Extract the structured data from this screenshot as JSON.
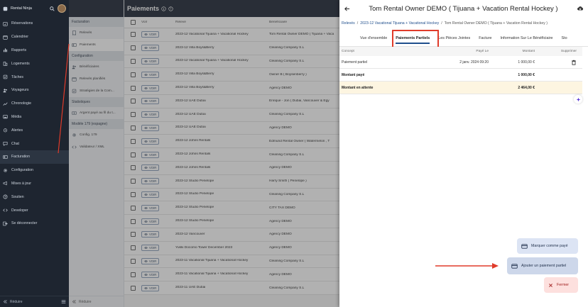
{
  "sidebar": {
    "app_name": "Rental Ninja",
    "items": [
      {
        "label": "Réservations",
        "icon": "calendar-check-icon"
      },
      {
        "label": "Calendrier",
        "icon": "calendar-icon"
      },
      {
        "label": "Rapports",
        "icon": "bar-chart-icon"
      },
      {
        "label": "Logements",
        "icon": "buildings-icon"
      },
      {
        "label": "Tâches",
        "icon": "tasks-icon"
      },
      {
        "label": "Voyageurs",
        "icon": "users-icon"
      },
      {
        "label": "Chronologie",
        "icon": "trend-icon"
      },
      {
        "label": "Média",
        "icon": "image-icon"
      },
      {
        "label": "Alertes",
        "icon": "alarm-icon"
      },
      {
        "label": "Chat",
        "icon": "chat-icon"
      },
      {
        "label": "Facturation",
        "icon": "invoice-icon"
      },
      {
        "label": "Configuration",
        "icon": "gear-icon"
      },
      {
        "label": "Mises à jour",
        "icon": "megaphone-icon"
      },
      {
        "label": "Soutien",
        "icon": "help-icon"
      },
      {
        "label": "Developer",
        "icon": "code-icon"
      },
      {
        "label": "Se déconnecter",
        "icon": "logout-icon"
      }
    ],
    "active_index": 10,
    "footer_label": "Réduire"
  },
  "subnav": {
    "sections": [
      {
        "title": "Facturation",
        "items": [
          {
            "label": "Relevés"
          },
          {
            "label": "Paiements"
          }
        ]
      },
      {
        "title": "Configuration",
        "items": [
          {
            "label": "Bénéficiaires"
          },
          {
            "label": "Relevés planifiés"
          },
          {
            "label": "Stratégies de la Com..."
          }
        ]
      },
      {
        "title": "Statistiques",
        "items": [
          {
            "label": "Argent payé au fil du t..."
          }
        ]
      },
      {
        "title": "Modèle 179 (espagne)",
        "items": [
          {
            "label": "Config. 179"
          },
          {
            "label": "Validateur / XML"
          }
        ]
      }
    ],
    "active_label": "Paiements",
    "footer_label": "Réduire"
  },
  "list": {
    "title": "Paiements",
    "columns": {
      "voir": "Voir",
      "releve": "Relevé",
      "beneficiaire": "Bénéficiaire"
    },
    "voir_label": "VOIR",
    "rows": [
      {
        "releve": "2023-12 Vacational Tijuana + Vacational Hockey",
        "beneficiaire": "Tom Rental Owner DEMO ( Tijuana + Vaca"
      },
      {
        "releve": "2023-12 Villa Boys&Berry",
        "beneficiaire": "Cleaning Company S.L"
      },
      {
        "releve": "2023-12 Vacational Tijuana + Vacational Hockey",
        "beneficiaire": "Cleaning Company S.L"
      },
      {
        "releve": "2023-12 Villa Boys&Berry",
        "beneficiaire": "Owner B ( Boysenberry )"
      },
      {
        "releve": "2023-12 Villa Boys&Berry",
        "beneficiaire": "Agency DEMO"
      },
      {
        "releve": "2023-12 UAE Dubai",
        "beneficiaire": "Enrique - Jon ( Dubai, Vancouver & Egy"
      },
      {
        "releve": "2023-12 UAE Dubai",
        "beneficiaire": "Cleaning Company S.L"
      },
      {
        "releve": "2023-12 UAE Dubai",
        "beneficiaire": "Agency DEMO"
      },
      {
        "releve": "2023-12 Johns Rentals",
        "beneficiaire": "Edmund Rental Owner ( Watermelon , T"
      },
      {
        "releve": "2023-12 Johns Rentals",
        "beneficiaire": "Cleaning Company S.L"
      },
      {
        "releve": "2023-12 Johns Rentals",
        "beneficiaire": "Agency DEMO"
      },
      {
        "releve": "2023-12 Studio Penelope",
        "beneficiaire": "Harry Smith ( Penelope )"
      },
      {
        "releve": "2023-12 Studio Penelope",
        "beneficiaire": "Cleaning Company S.L"
      },
      {
        "releve": "2023-12 Studio Penelope",
        "beneficiaire": "CITY TAX DEMO"
      },
      {
        "releve": "2023-12 Studio Penelope",
        "beneficiaire": "Agency DEMO"
      },
      {
        "releve": "2023-12 Vancouver",
        "beneficiaire": "Agency DEMO"
      },
      {
        "releve": "Yukki Docomo Tower December 2023",
        "beneficiaire": "Agency DEMO"
      },
      {
        "releve": "2023-11 Vacational Tijuana + Vacational Hockey",
        "beneficiaire": "Cleaning Company S.L"
      },
      {
        "releve": "2023-11 Vacational Tijuana + Vacational Hockey",
        "beneficiaire": "Agency DEMO"
      },
      {
        "releve": "2023-11 UAE Dubai",
        "beneficiaire": "Cleaning Company S.L"
      }
    ]
  },
  "panel": {
    "title": "Tom Rental Owner DEMO ( Tijuana + Vacation Rental Hockey )",
    "breadcrumb": [
      "Relevés",
      "2023-12 Vacational Tijuana + Vacational Hockey",
      "Tom Rental Owner DEMO ( Tijuana + Vacation Rental Hockey )"
    ],
    "tabs": [
      {
        "label": "Vue d'ensemble"
      },
      {
        "label": "Paiements Partiels"
      },
      {
        "label": "Les Pièces Jointes"
      },
      {
        "label": "Facture"
      },
      {
        "label": "Information Sur Le Bénéficiaire"
      },
      {
        "label": "Sto"
      }
    ],
    "active_tab": "Paiements Partiels",
    "table": {
      "headers": {
        "concept": "Concept",
        "paye_le": "Payé Le",
        "montant": "Montant",
        "supprimer": "Supprimer"
      },
      "rows": [
        {
          "concept": "Paiement partiel",
          "paye_le": "2 janv. 2024 09:20",
          "montant": "1 000,00 €"
        }
      ],
      "totals": [
        {
          "label": "Montant payé",
          "montant": "1 000,00 €"
        },
        {
          "label": "Montant en attente",
          "montant": "2 464,00 €"
        }
      ]
    },
    "actions": {
      "mark_paid": "Marquer comme payé",
      "add_payment": "Ajouter un paiement partiel",
      "close": "Fermer"
    }
  },
  "colors": {
    "sidebar_bg": "#1e2530",
    "accent": "#1f4e8c",
    "highlight": "#e03b2a",
    "pending_bg": "#fdf5e1"
  }
}
